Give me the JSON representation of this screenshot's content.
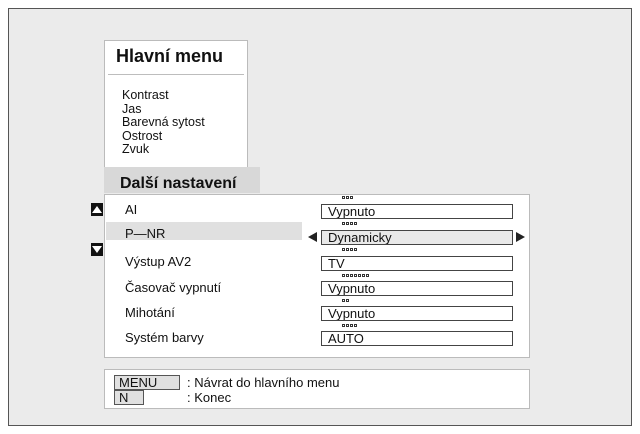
{
  "main_menu": {
    "title": "Hlavní menu",
    "items": [
      "Kontrast",
      "Jas",
      "Barevná sytost",
      "Ostrost",
      "Zvuk"
    ]
  },
  "submenu": {
    "title": "Další nastavení",
    "rows": [
      {
        "label": "AI",
        "value": "Vypnuto",
        "dots": 3
      },
      {
        "label": "P—NR",
        "value": "Dynamicky",
        "dots": 4
      },
      {
        "label": "Výstup AV2",
        "value": "TV",
        "dots": 4
      },
      {
        "label": "Časovač vypnutí",
        "value": "Vypnuto",
        "dots": 7
      },
      {
        "label": "Mihotání",
        "value": "Vypnuto",
        "dots": 2
      },
      {
        "label": "Systém barvy",
        "value": "AUTO",
        "dots": 4
      }
    ]
  },
  "help": {
    "menu_key": "MENU",
    "menu_desc": ": Návrat do hlavního menu",
    "n_key": "N",
    "n_desc": ": Konec"
  },
  "icons": {
    "scroll_up": "up-triangle-icon",
    "scroll_down": "down-triangle-icon",
    "value_left": "left-triangle-icon",
    "value_right": "right-triangle-icon"
  }
}
